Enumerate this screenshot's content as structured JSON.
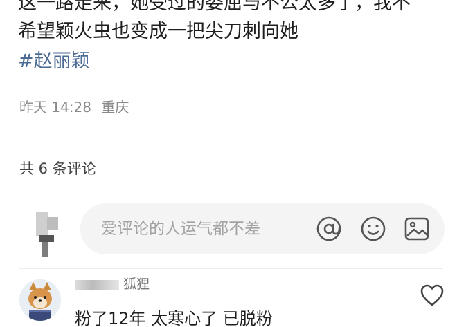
{
  "post": {
    "line1": "这一路走来，她受过的委屈与不公太多了，我不",
    "line2": "希望颖火虫也变成一把尖刀刺向她",
    "hashtag": "#赵丽颖",
    "time": "昨天 14:28",
    "location": "重庆"
  },
  "comments_section": {
    "count_label": "共 6 条评论",
    "input": {
      "placeholder": "爱评论的人运气都不差",
      "icons": [
        "at-icon",
        "smile-icon",
        "image-icon"
      ]
    }
  },
  "comments": [
    {
      "user": "狐狸",
      "text": "粉了12年 太寒心了 已脱粉",
      "icon": "heart-outline-icon"
    }
  ],
  "colors": {
    "hashtag": "#4c6b94",
    "meta": "#8a8a8a",
    "input_bg": "#f4f4f4"
  }
}
